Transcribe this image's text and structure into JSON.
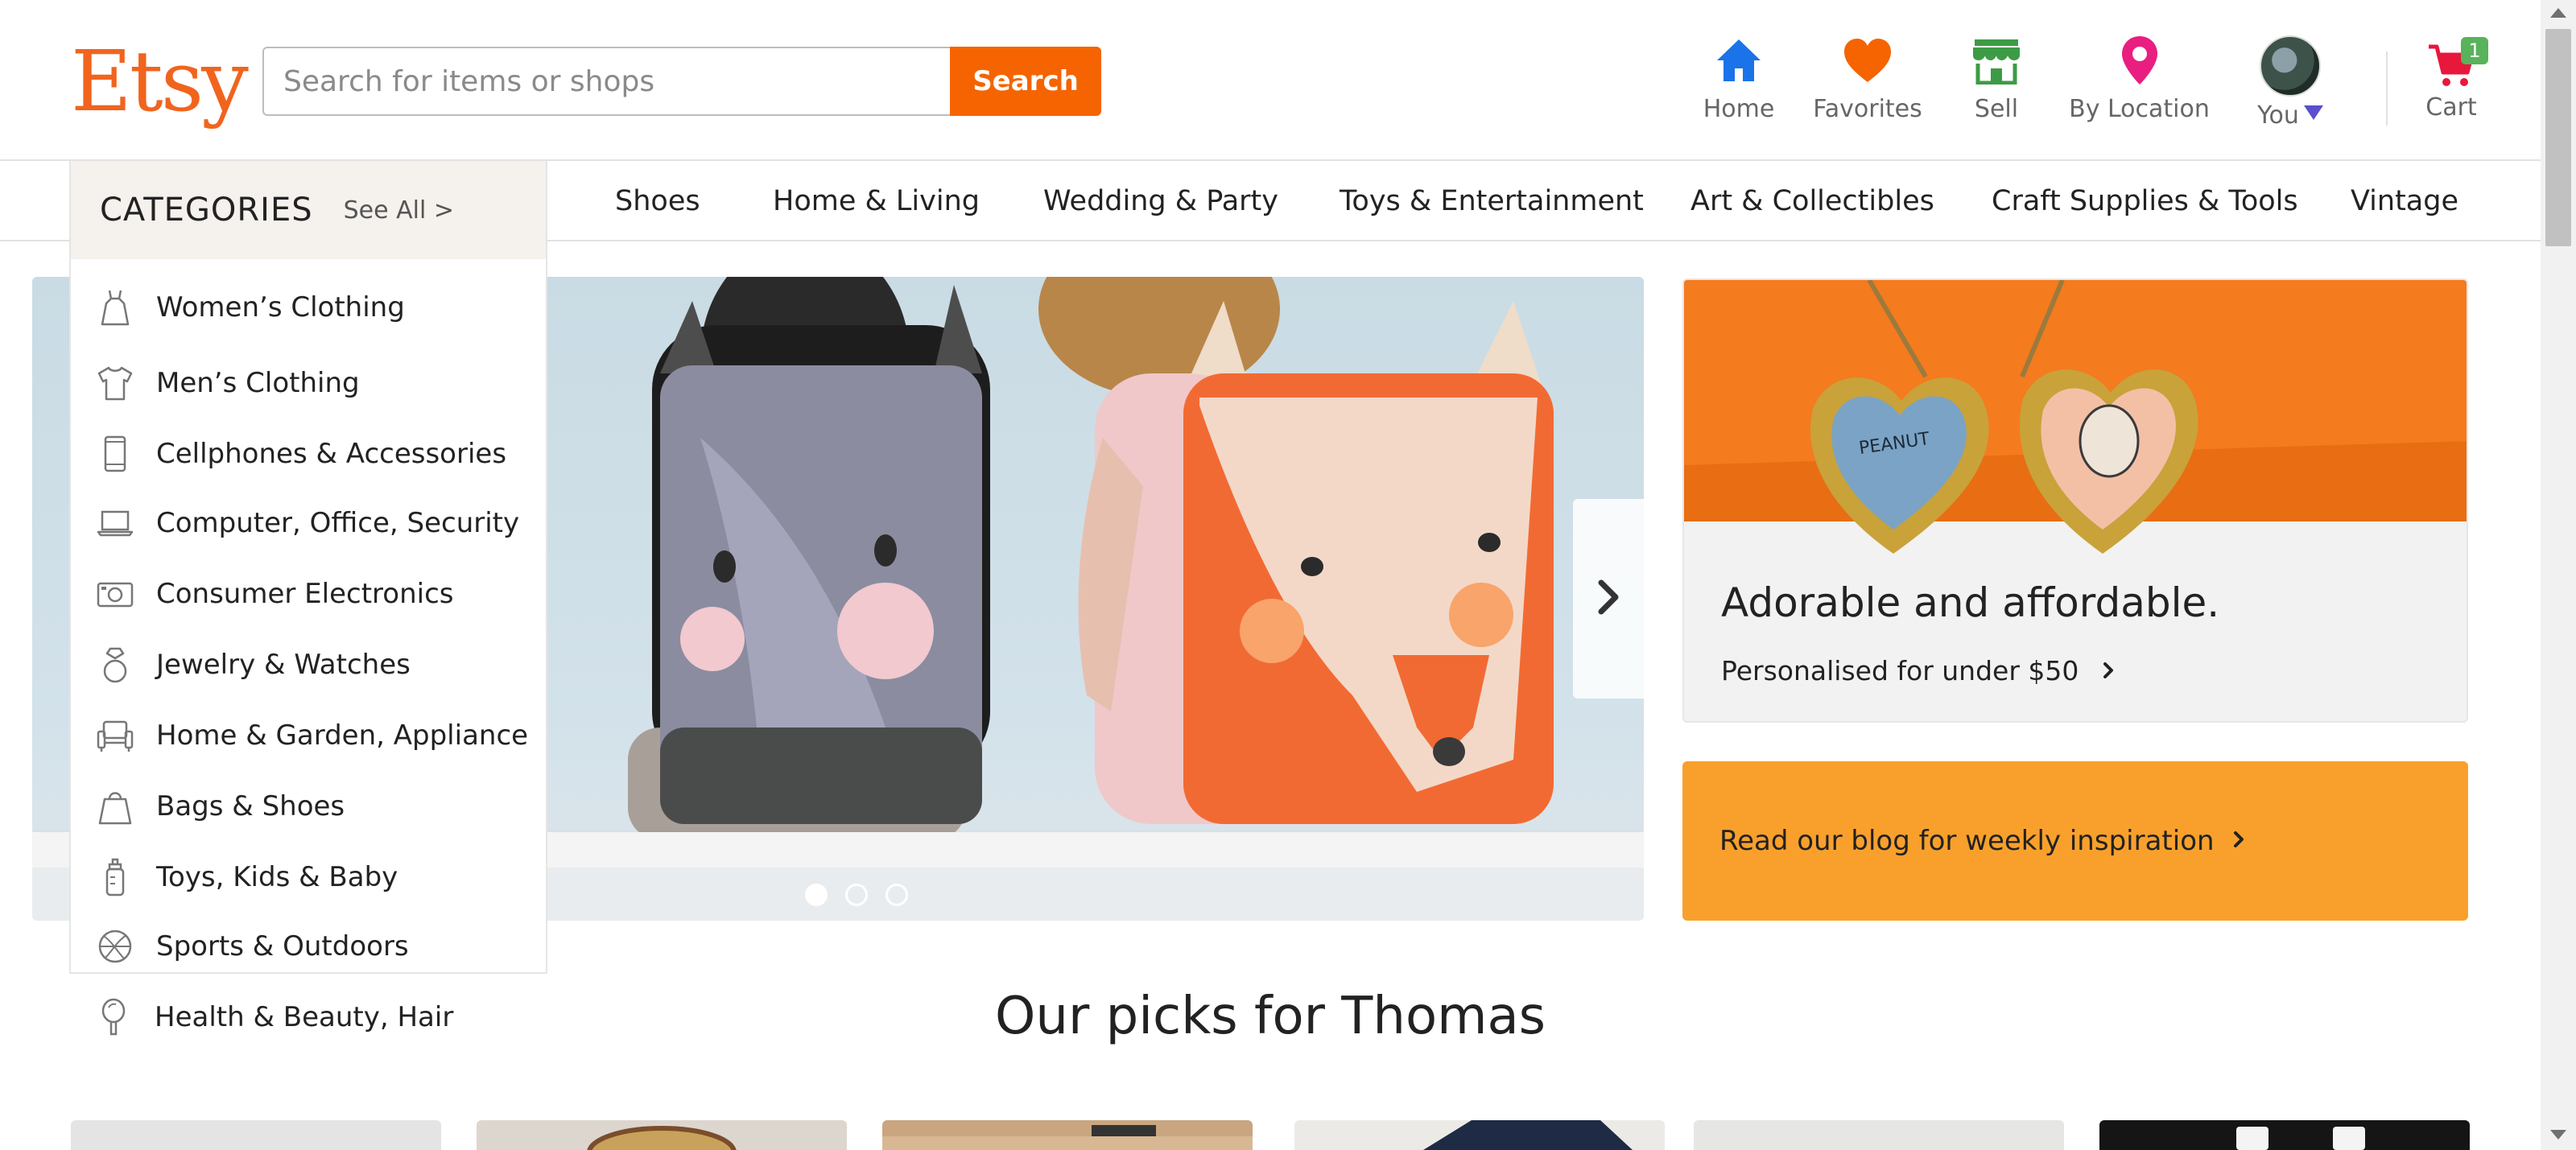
{
  "header": {
    "logo": "Etsy",
    "search": {
      "placeholder": "Search for items or shops",
      "value": "",
      "button_label": "Search"
    },
    "nav": {
      "home": "Home",
      "favorites": "Favorites",
      "sell": "Sell",
      "by_location": "By Location",
      "you": "You",
      "cart": "Cart",
      "cart_count": "1"
    }
  },
  "category_bar": [
    "Shoes",
    "Home & Living",
    "Wedding & Party",
    "Toys & Entertainment",
    "Art & Collectibles",
    "Craft Supplies & Tools",
    "Vintage"
  ],
  "categories_panel": {
    "title": "CATEGORIES",
    "see_all": "See All >",
    "items": [
      {
        "label": "Women’s Clothing",
        "icon": "dress-icon"
      },
      {
        "label": "Men’s Clothing",
        "icon": "shirt-icon"
      },
      {
        "label": "Cellphones & Accessories",
        "icon": "phone-icon"
      },
      {
        "label": "Computer, Office, Security",
        "icon": "laptop-icon"
      },
      {
        "label": "Consumer Electronics",
        "icon": "camera-icon"
      },
      {
        "label": "Jewelry & Watches",
        "icon": "ring-icon"
      },
      {
        "label": "Home & Garden, Appliance",
        "icon": "armchair-icon"
      },
      {
        "label": "Bags & Shoes",
        "icon": "bag-icon"
      },
      {
        "label": "Toys, Kids & Baby",
        "icon": "bottle-icon"
      },
      {
        "label": "Sports & Outdoors",
        "icon": "ball-icon"
      },
      {
        "label": "Health & Beauty, Hair",
        "icon": "mirror-icon"
      }
    ]
  },
  "hero": {
    "slide_count": 3,
    "active_slide": 1
  },
  "promos": [
    {
      "title": "Adorable and affordable.",
      "link": "Personalised for under $50",
      "locket_text": "PEANUT"
    },
    {
      "text": "Read our blog for weekly inspiration"
    }
  ],
  "picks": {
    "title": "Our picks for Thomas"
  },
  "colors": {
    "brand": "#f1641e",
    "search_button": "#f56400",
    "home_icon": "#1a73e8",
    "favorites_icon": "#f56400",
    "sell_icon": "#3d9b46",
    "location_icon": "#e91e80",
    "cart_icon": "#e8173c",
    "cart_badge": "#58b35a",
    "promo_orange": "#f9a02c"
  }
}
